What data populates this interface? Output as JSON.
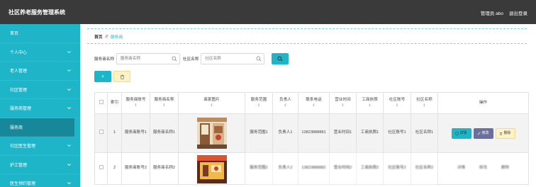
{
  "header": {
    "title": "社区养老服务管理系统",
    "role_user": "管理员 abo",
    "logout": "退出登录"
  },
  "sidebar": {
    "items": [
      {
        "label": "首页"
      },
      {
        "label": "个人中心"
      },
      {
        "label": "老人管理"
      },
      {
        "label": "社区管理"
      },
      {
        "label": "服务商管理"
      },
      {
        "label": "服务商"
      },
      {
        "label": "社区医生管理"
      },
      {
        "label": "护工管理"
      },
      {
        "label": "医生预约管理"
      }
    ]
  },
  "breadcrumb": {
    "home": "首页",
    "sep": "//",
    "current": "服务商"
  },
  "search": {
    "name_label": "服务商名称",
    "name_placeholder": "服务商名称",
    "community_label": "社区名称",
    "community_placeholder": "社区名称"
  },
  "toolbar": {
    "add": "+"
  },
  "table": {
    "columns": [
      "索引",
      "服务商账号",
      "服务商名称",
      "商家图片",
      "服务范围",
      "负责人",
      "联系电话",
      "营业时间",
      "工商执照",
      "社区账号",
      "社区名称",
      "操作"
    ],
    "sort_mark": "⇕",
    "rows": [
      {
        "index": "1",
        "account": "服务商账号1",
        "name": "服务商名称1",
        "scope": "服务范围1",
        "manager": "负责人1",
        "phone": "13823888881",
        "hours": "营业时间1",
        "license": "工商执照1",
        "community_account": "社区账号1",
        "community_name": "社区名称1"
      },
      {
        "index": "2",
        "account": "服务商账号2",
        "name": "服务商名称2",
        "scope": "服务范围2",
        "manager": "负责人2",
        "phone": "13823888882",
        "hours": "营业时间2",
        "license": "工商执照2",
        "community_account": "社区账号2",
        "community_name": "社区名称2"
      }
    ],
    "actions": {
      "detail": "详情",
      "edit": "修改",
      "delete": "删除"
    }
  },
  "colors": {
    "topbar": "#3a3a3a",
    "accent": "#1fb5c9",
    "active_item": "#17879a",
    "edit_button": "#6b6f9e",
    "delete_button": "#fff3c6"
  }
}
